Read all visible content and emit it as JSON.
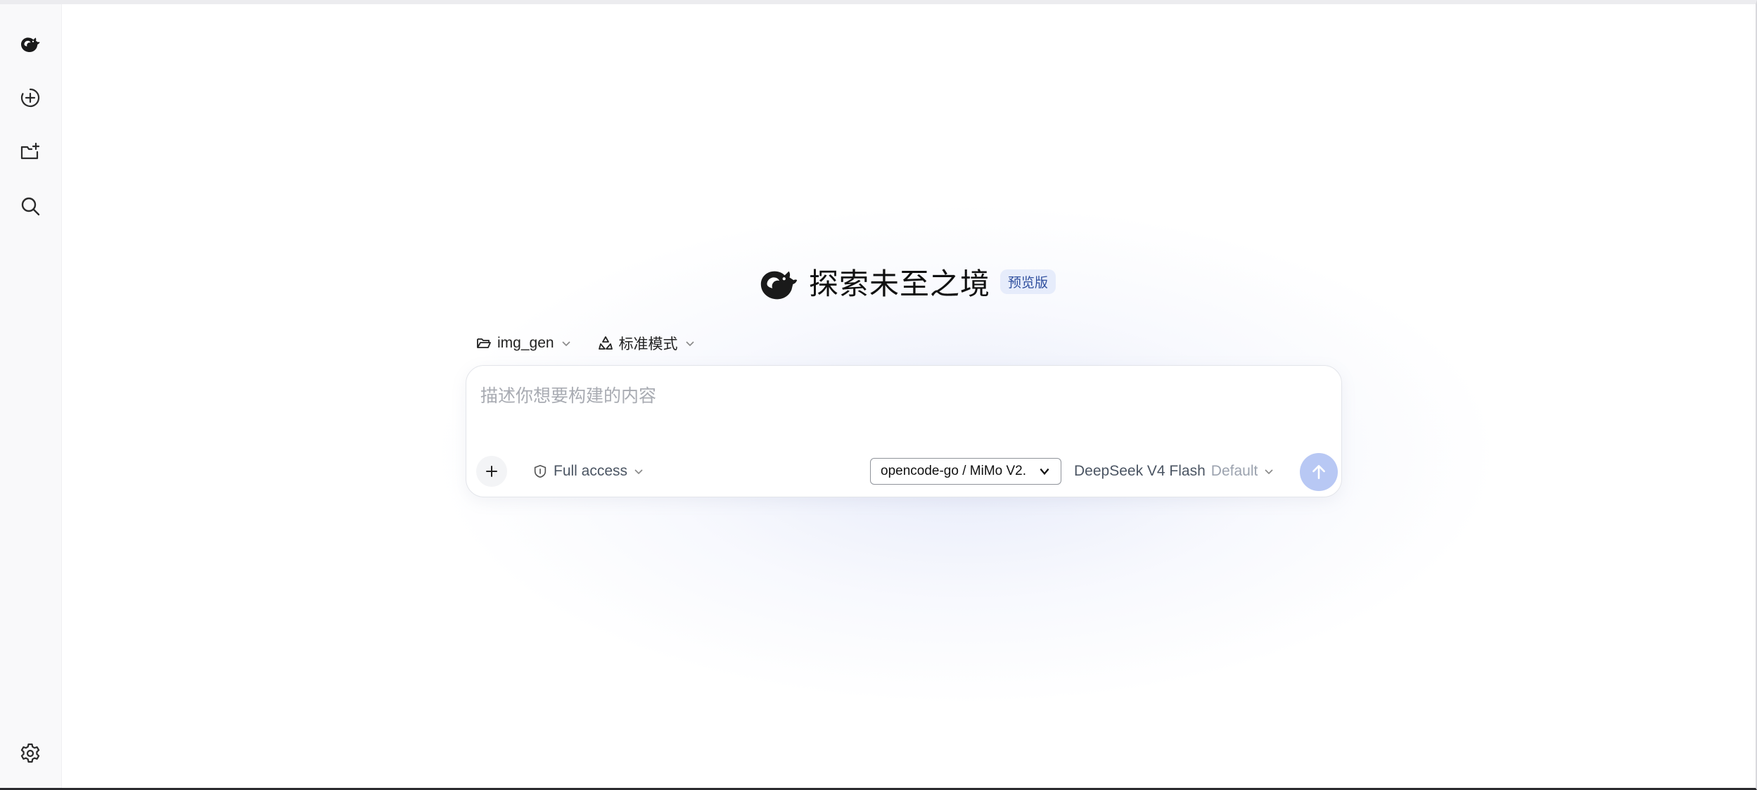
{
  "sidebar": {
    "logo_icon": "deepseek-whale-icon",
    "items": [
      {
        "id": "new-chat",
        "icon": "plus-circle-icon"
      },
      {
        "id": "new-project",
        "icon": "folder-plus-icon"
      },
      {
        "id": "search",
        "icon": "search-icon"
      }
    ],
    "settings_icon": "gear-icon"
  },
  "hero": {
    "title": "探索未至之境",
    "badge": "预览版"
  },
  "selectors": {
    "folder_label": "img_gen",
    "mode_label": "标准模式"
  },
  "composer": {
    "placeholder": "描述你想要构建的内容",
    "access_label": "Full access",
    "provider_label": "opencode-go / MiMo V2.",
    "model_name": "DeepSeek V4 Flash",
    "model_tag": "Default"
  },
  "colors": {
    "accent": "#b8c8f4",
    "badge_bg": "#e6ecfb",
    "badge_text": "#2f4f9e"
  }
}
